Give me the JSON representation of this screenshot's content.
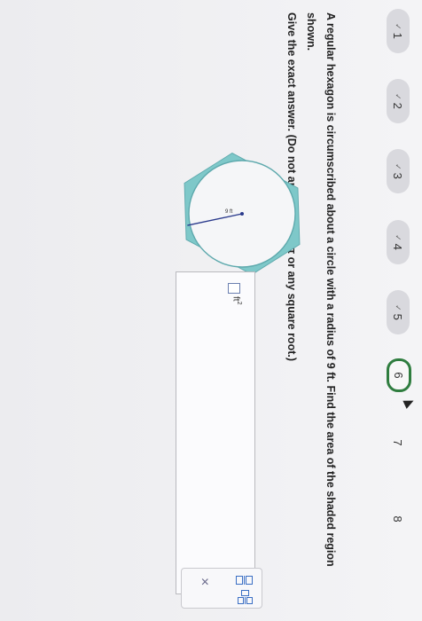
{
  "question_nav": {
    "items": [
      {
        "label": "1",
        "state": "done"
      },
      {
        "label": "2",
        "state": "done"
      },
      {
        "label": "3",
        "state": "done"
      },
      {
        "label": "4",
        "state": "done"
      },
      {
        "label": "5",
        "state": "done"
      },
      {
        "label": "6",
        "state": "current"
      },
      {
        "label": "7",
        "state": "open"
      },
      {
        "label": "8",
        "state": "open"
      }
    ],
    "checkmark": "✓",
    "current_color": "#2f7d3f"
  },
  "question": {
    "text": "A regular hexagon is circumscribed about a circle with a radius of 9 ft. Find the area of the shaded region shown.",
    "instruction": "Give the exact answer. (Do not approximate π or any square root.)"
  },
  "figure": {
    "radius_label": "9 ft",
    "shade_color": "#7ec8c9"
  },
  "answer": {
    "unit": "ft",
    "unit_exponent": "2"
  },
  "toolbar": {
    "close_symbol": "×"
  }
}
